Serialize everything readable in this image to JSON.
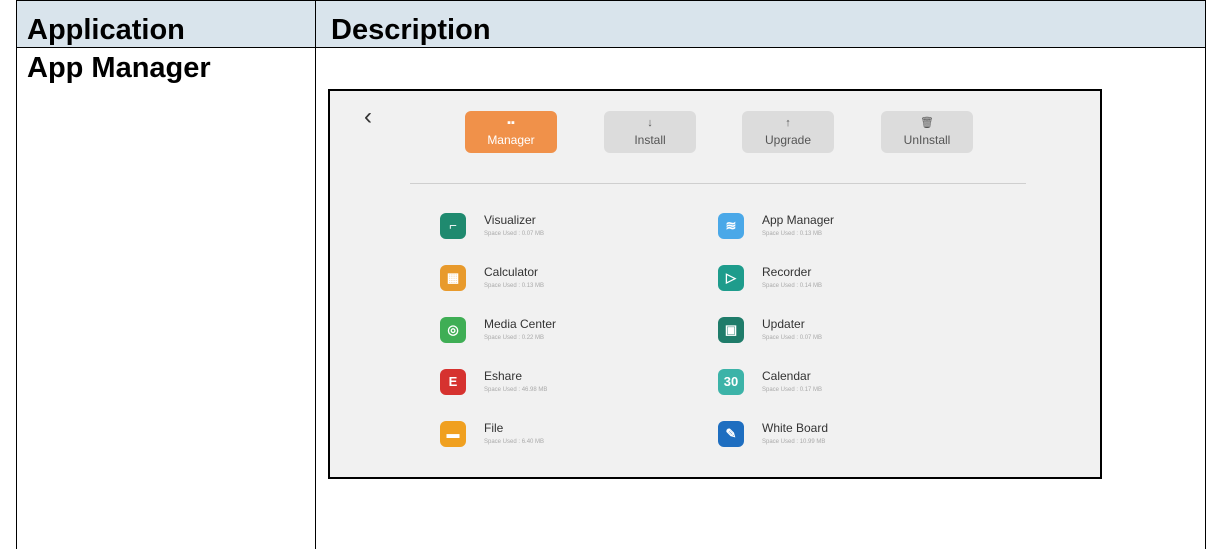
{
  "table": {
    "headers": [
      "Application",
      "Description"
    ],
    "row_title": "App Manager"
  },
  "screen": {
    "back_icon": "chevron-left-icon",
    "tabs": [
      {
        "label": "Manager",
        "icon": "grid-icon",
        "glyph": "▪▪",
        "active": true
      },
      {
        "label": "Install",
        "icon": "arrow-down-icon",
        "glyph": "↓",
        "active": false
      },
      {
        "label": "Upgrade",
        "icon": "arrow-up-icon",
        "glyph": "↑",
        "active": false
      },
      {
        "label": "UnInstall",
        "icon": "trash-icon",
        "glyph": "🗑",
        "active": false
      }
    ],
    "apps": [
      {
        "name": "Visualizer",
        "used": "Space Used : 0.07 MB",
        "color": "#1f8a6f",
        "glyph": "⌐"
      },
      {
        "name": "App Manager",
        "used": "Space Used : 0.13 MB",
        "color": "#4aa8e8",
        "glyph": "≋"
      },
      {
        "name": "Calculator",
        "used": "Space Used : 0.13 MB",
        "color": "#e89a2c",
        "glyph": "▦"
      },
      {
        "name": "Recorder",
        "used": "Space Used : 0.14 MB",
        "color": "#1e9c8c",
        "glyph": "▷"
      },
      {
        "name": "Media Center",
        "used": "Space Used : 0.22 MB",
        "color": "#3fae55",
        "glyph": "◎"
      },
      {
        "name": "Updater",
        "used": "Space Used : 0.07 MB",
        "color": "#1f7c6a",
        "glyph": "▣"
      },
      {
        "name": "Eshare",
        "used": "Space Used : 46.98 MB",
        "color": "#d6322f",
        "glyph": "E"
      },
      {
        "name": "Calendar",
        "used": "Space Used : 0.17 MB",
        "color": "#3cb3a8",
        "glyph": "30"
      },
      {
        "name": "File",
        "used": "Space Used : 6.40 MB",
        "color": "#f0a020",
        "glyph": "▬"
      },
      {
        "name": "White Board",
        "used": "Space Used : 10.99 MB",
        "color": "#1e6ec0",
        "glyph": "✎"
      }
    ]
  }
}
